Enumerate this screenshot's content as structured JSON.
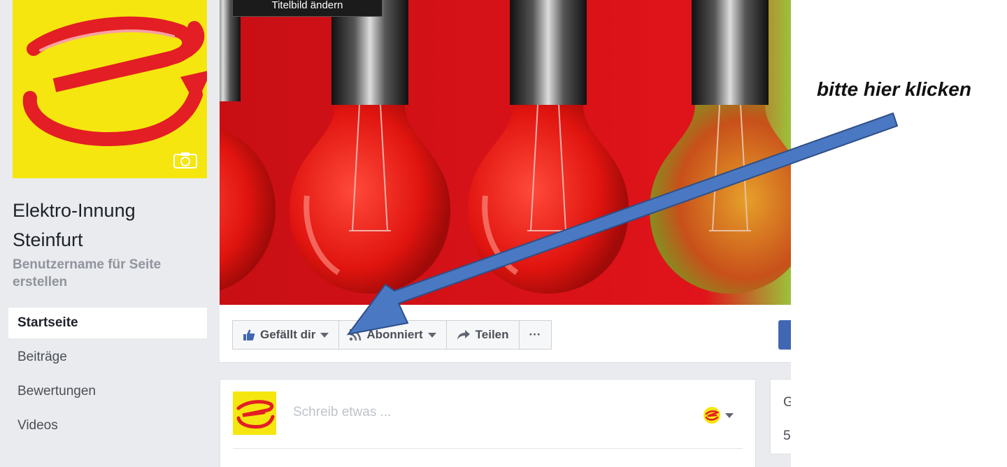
{
  "page": {
    "name_line1": "Elektro-Innung",
    "name_line2": "Steinfurt",
    "username_line1": "Benutzername für Seite",
    "username_line2": "erstellen"
  },
  "cover": {
    "change_button": "Titelbild ändern"
  },
  "nav": {
    "items": [
      {
        "label": "Startseite"
      },
      {
        "label": "Beiträge"
      },
      {
        "label": "Bewertungen"
      },
      {
        "label": "Videos"
      }
    ]
  },
  "actions": {
    "like": "Gefällt dir",
    "follow": "Abonniert",
    "share": "Teilen",
    "more": "···"
  },
  "composer": {
    "placeholder": "Schreib etwas ..."
  },
  "right_box": {
    "line1": "G",
    "line2": "5"
  },
  "annotation": {
    "text": "bitte hier klicken"
  },
  "colors": {
    "brand_yellow": "#f5e60f",
    "brand_red": "#e31e24",
    "cover_red": "#d9141b",
    "arrow_blue": "#4a78c2",
    "fb_blue": "#4267b2"
  },
  "icons": {
    "camera": "camera-icon",
    "like": "thumbs-up-icon",
    "follow": "rss-icon",
    "share": "share-arrow-icon",
    "audience": "page-avatar-icon"
  }
}
